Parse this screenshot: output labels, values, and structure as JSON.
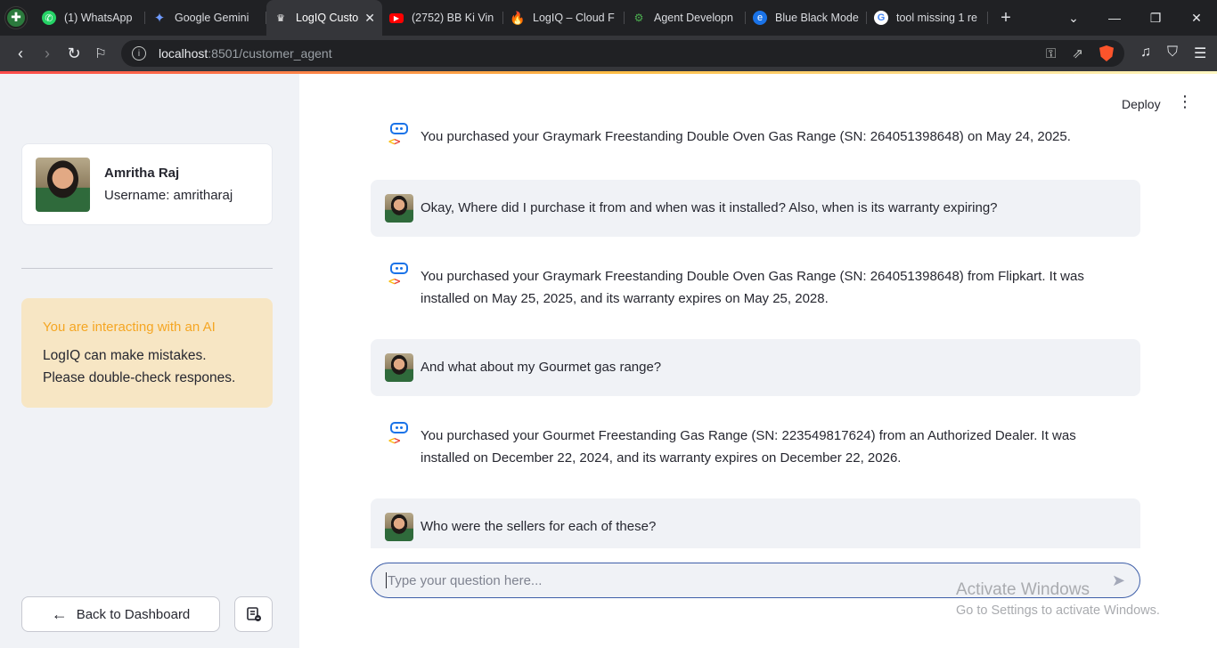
{
  "browser": {
    "tabs": [
      {
        "title": "(1) WhatsApp",
        "icon": "whatsapp-icon",
        "active": false
      },
      {
        "title": "Google Gemini",
        "icon": "gemini-icon",
        "active": false
      },
      {
        "title": "LogIQ Custo",
        "icon": "streamlit-icon",
        "active": true
      },
      {
        "title": "(2752) BB Ki Vin",
        "icon": "youtube-icon",
        "active": false
      },
      {
        "title": "LogIQ – Cloud F",
        "icon": "firebase-icon",
        "active": false
      },
      {
        "title": "Agent Developn",
        "icon": "agent-icon",
        "active": false
      },
      {
        "title": "Blue Black Mode",
        "icon": "edge-icon",
        "active": false
      },
      {
        "title": "tool missing 1 re",
        "icon": "google-icon",
        "active": false
      }
    ],
    "address": {
      "host": "localhost",
      "path": ":8501/customer_agent"
    }
  },
  "sidebar": {
    "profile": {
      "name": "Amritha Raj",
      "username": "Username: amritharaj"
    },
    "notice": {
      "title": "You are interacting with an AI",
      "body": "LogIQ can make mistakes. Please double-check respones."
    },
    "back_button": "Back to Dashboard"
  },
  "header": {
    "deploy_label": "Deploy"
  },
  "chat": {
    "messages": [
      {
        "role": "assistant",
        "text": "You purchased your Graymark Freestanding Double Oven Gas Range (SN: 264051398648) on May 24, 2025."
      },
      {
        "role": "user",
        "text": "Okay, Where did I purchase it from and when was it installed? Also, when is its warranty expiring?"
      },
      {
        "role": "assistant",
        "text": "You purchased your Graymark Freestanding Double Oven Gas Range (SN: 264051398648) from Flipkart. It was installed on May 25, 2025, and its warranty expires on May 25, 2028."
      },
      {
        "role": "user",
        "text": "And what about my Gourmet gas range?"
      },
      {
        "role": "assistant",
        "text": "You purchased your Gourmet Freestanding Gas Range (SN: 223549817624) from an Authorized Dealer. It was installed on December 22, 2024, and its warranty expires on December 22, 2026."
      },
      {
        "role": "user",
        "text": "Who were the sellers for each of these?"
      }
    ],
    "input": {
      "placeholder": "Type your question here...",
      "value": ""
    }
  },
  "watermark": {
    "line1": "Activate Windows",
    "line2": "Go to Settings to activate Windows."
  }
}
